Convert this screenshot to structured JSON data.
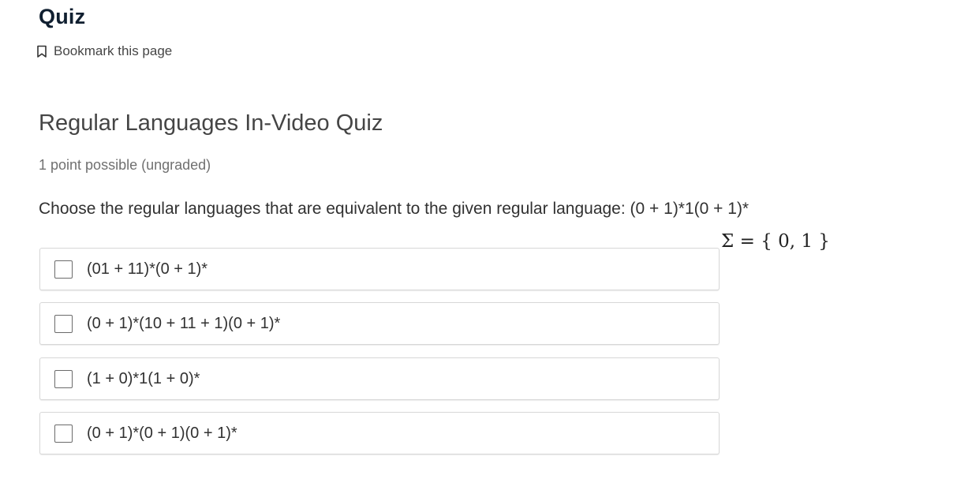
{
  "header": {
    "title": "Quiz",
    "bookmark_label": "Bookmark this page",
    "bookmark_icon": "bookmark-outline-icon"
  },
  "problem": {
    "title": "Regular Languages In-Video Quiz",
    "points": "1 point possible (ungraded)",
    "prompt": "Choose the regular languages that are equivalent to the given regular language: (0 + 1)*1(0 + 1)*",
    "alphabet": "Σ = { 0, 1 }",
    "options": [
      {
        "label": "(01 + 11)*(0 + 1)*",
        "checked": false
      },
      {
        "label": "(0 + 1)*(10 + 11 + 1)(0 + 1)*",
        "checked": false
      },
      {
        "label": "(1 + 0)*1(1 + 0)*",
        "checked": false
      },
      {
        "label": "(0 + 1)*(0 + 1)(0 + 1)*",
        "checked": false
      }
    ]
  }
}
